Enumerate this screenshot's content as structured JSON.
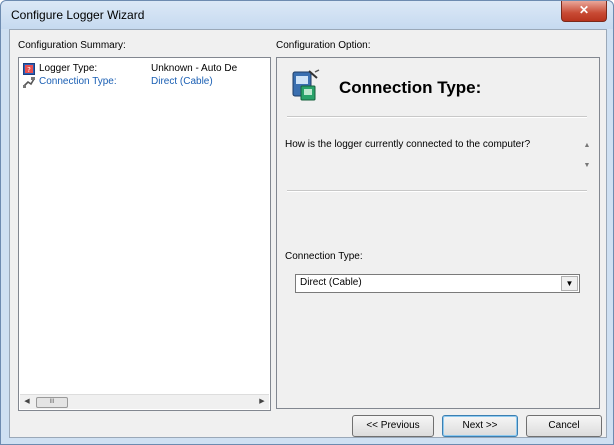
{
  "window": {
    "title": "Configure Logger Wizard",
    "close_glyph": "✕"
  },
  "summary": {
    "label": "Configuration Summary:",
    "rows": [
      {
        "name": "Logger Type:",
        "value": "Unknown - Auto De",
        "icon": "logger-icon"
      },
      {
        "name": "Connection Type:",
        "value": "Direct (Cable)",
        "icon": "cable-icon"
      }
    ],
    "scroll_thumb": "III"
  },
  "option": {
    "label": "Configuration Option:",
    "heading": "Connection Type:",
    "question": "How is the logger currently connected to the computer?",
    "field_label": "Connection Type:",
    "field_value": "Direct (Cable)"
  },
  "buttons": {
    "previous": "<< Previous",
    "next": "Next >>",
    "cancel": "Cancel"
  },
  "colors": {
    "selected_text": "#1a5fb4",
    "close_button": "#c84a34"
  }
}
